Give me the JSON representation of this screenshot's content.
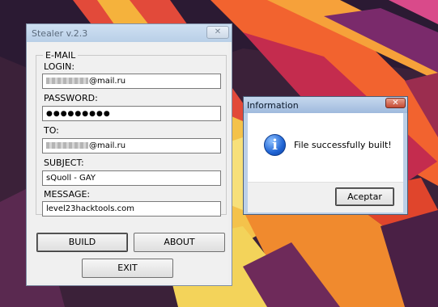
{
  "stealer_window": {
    "title": "Stealer v.2.3",
    "close_glyph": "✕",
    "group_label": "E-MAIL",
    "login": {
      "label": "LOGIN:",
      "value_suffix": "@mail.ru"
    },
    "password": {
      "label": "PASSWORD:",
      "masked_value": "●●●●●●●●●"
    },
    "to": {
      "label": "TO:",
      "value_suffix": "@mail.ru"
    },
    "subject": {
      "label": "SUBJECT:",
      "value": "sQuoll - GAY"
    },
    "message": {
      "label": "MESSAGE:",
      "value": "level23hacktools.com"
    },
    "buttons": {
      "build": "BUILD",
      "about": "ABOUT",
      "exit": "EXIT"
    }
  },
  "info_dialog": {
    "title": "Information",
    "close_glyph": "✕",
    "icon": "information-icon",
    "message": "File successfully built!",
    "ok_label": "Aceptar"
  },
  "colors": {
    "window_bg": "#f0f0f0",
    "titlebar_inactive": "#b9cfe7",
    "titlebar_active": "#9fbadd",
    "close_button_red": "#c44a33",
    "info_icon_blue": "#1f64d4"
  }
}
